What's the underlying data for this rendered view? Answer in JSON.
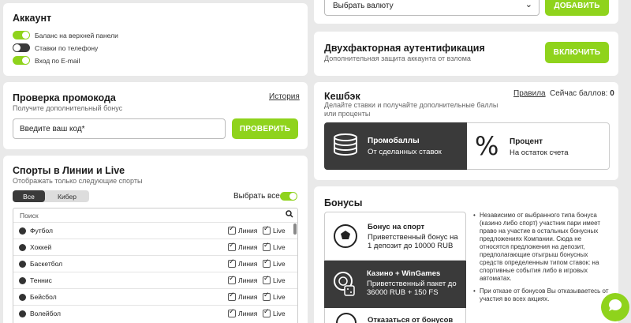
{
  "account": {
    "title": "Аккаунт",
    "toggles": [
      {
        "label": "Баланс на верхней панели",
        "on": true
      },
      {
        "label": "Ставки по телефону",
        "on": false
      },
      {
        "label": "Вход по E-mail",
        "on": true
      }
    ]
  },
  "currency": {
    "placeholder": "Выбрать валюту",
    "add_label": "ДОБАВИТЬ"
  },
  "twofa": {
    "title": "Двухфакторная аутентификация",
    "subtitle": "Дополнительная защита аккаунта от взлома",
    "button": "ВКЛЮЧИТЬ"
  },
  "promo": {
    "title": "Проверка промокода",
    "subtitle": "Получите дополнительный бонус",
    "history": "История",
    "placeholder": "Введите ваш код*",
    "button": "ПРОВЕРИТЬ"
  },
  "cashback": {
    "title": "Кешбэк",
    "subtitle": "Делайте ставки и получайте дополнительные баллы или проценты",
    "rules": "Правила",
    "points_label": "Сейчас баллов:",
    "points_value": "0",
    "options": [
      {
        "title": "Промобаллы",
        "desc": "От сделанных ставок"
      },
      {
        "title": "Процент",
        "desc": "На остаток счета"
      }
    ]
  },
  "sports": {
    "title": "Спорты в Линии и Live",
    "subtitle": "Отображать только следующие спорты",
    "tabs": [
      "Все",
      "Кибер"
    ],
    "select_all": "Выбрать все",
    "search_placeholder": "Поиск",
    "line_label": "Линия",
    "live_label": "Live",
    "items": [
      {
        "name": "Футбол"
      },
      {
        "name": "Хоккей"
      },
      {
        "name": "Баскетбол"
      },
      {
        "name": "Теннис"
      },
      {
        "name": "Бейсбол"
      },
      {
        "name": "Волейбол"
      }
    ]
  },
  "bonuses": {
    "title": "Бонусы",
    "items": [
      {
        "title": "Бонус на спорт",
        "desc": "Приветственный бонус на 1 депозит до 10000 RUB"
      },
      {
        "title": "Казино + WinGames",
        "desc": "Приветственный пакет до 36000 RUB + 150 FS"
      },
      {
        "title": "Отказаться от бонусов",
        "desc": ""
      }
    ],
    "notes": [
      "Независимо от выбранного типа бонуса (казино либо спорт) участник пари имеет право на участие в остальных бонусных предложениях Компании. Сюда не относятся предложения на депозит, предполагающие отыгрыш бонусных средств определенным типом ставок: на спортивные события либо в игровых автоматах.",
      "При отказе от бонусов Вы отказываетесь от участия во всех акциях."
    ]
  },
  "colors": {
    "accent": "#8fd31c",
    "dark": "#3a3a3a"
  }
}
